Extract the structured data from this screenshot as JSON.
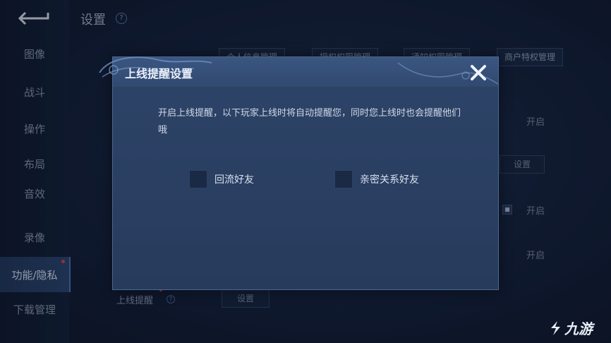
{
  "header": {
    "title": "设置",
    "help": "?"
  },
  "sidebar": {
    "items": [
      {
        "label": "图像"
      },
      {
        "label": "战斗"
      },
      {
        "label": "操作"
      },
      {
        "label": "布局"
      },
      {
        "label": "音效"
      },
      {
        "label": "录像"
      },
      {
        "label": "功能/隐私",
        "active": true
      },
      {
        "label": "下载管理"
      }
    ]
  },
  "top_tabs": [
    "个人信息管理",
    "授权权限管理",
    "通知权限管理",
    "商户特权管理"
  ],
  "right_panel": {
    "row1": "开启",
    "row2_button": "设置",
    "row3": "开启",
    "row4": "开启"
  },
  "bottom_row": {
    "label": "上线提醒",
    "help": "?",
    "button": "设置"
  },
  "modal": {
    "title": "上线提醒设置",
    "description": "开启上线提醒，以下玩家上线时将自动提醒您，同时您上线时也会提醒他们哦",
    "options": [
      {
        "label": "回流好友",
        "checked": false
      },
      {
        "label": "亲密关系好友",
        "checked": false
      }
    ]
  },
  "watermark": {
    "text": "九游"
  },
  "colors": {
    "accent": "#4b6790",
    "badge_red": "#d94b3d",
    "modal_bg": "#2d4468"
  }
}
